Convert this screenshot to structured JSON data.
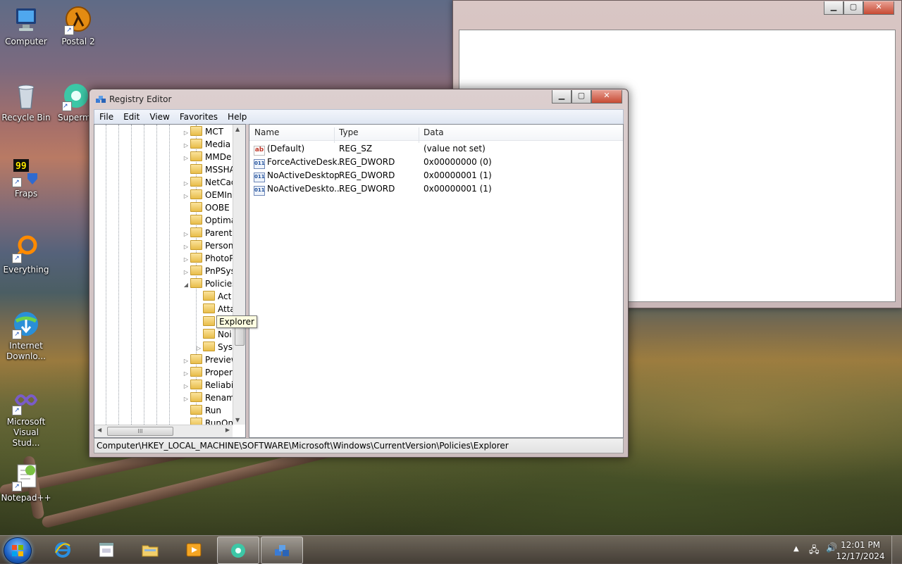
{
  "desktop": {
    "icons": [
      {
        "label": "Computer"
      },
      {
        "label": "Postal 2"
      },
      {
        "label": "Recycle Bin"
      },
      {
        "label": "Supermi"
      },
      {
        "label": "Fraps"
      },
      {
        "label": "Everything"
      },
      {
        "label": "Internet Downlo..."
      },
      {
        "label": "Microsoft Visual Stud..."
      },
      {
        "label": "Notepad++"
      }
    ]
  },
  "registry": {
    "title": "Registry Editor",
    "menu": [
      "File",
      "Edit",
      "View",
      "Favorites",
      "Help"
    ],
    "tree": [
      {
        "label": "MCT",
        "depth": 0,
        "expander": "▷"
      },
      {
        "label": "Media",
        "depth": 0,
        "expander": "▷"
      },
      {
        "label": "MMDe",
        "depth": 0,
        "expander": "▷"
      },
      {
        "label": "MSSHA",
        "depth": 0,
        "expander": ""
      },
      {
        "label": "NetCac",
        "depth": 0,
        "expander": "▷"
      },
      {
        "label": "OEMIn",
        "depth": 0,
        "expander": "▷"
      },
      {
        "label": "OOBE",
        "depth": 0,
        "expander": ""
      },
      {
        "label": "Optima",
        "depth": 0,
        "expander": ""
      },
      {
        "label": "Parenta",
        "depth": 0,
        "expander": "▷"
      },
      {
        "label": "Person",
        "depth": 0,
        "expander": "▷"
      },
      {
        "label": "PhotoP",
        "depth": 0,
        "expander": "▷"
      },
      {
        "label": "PnPSys",
        "depth": 0,
        "expander": "▷"
      },
      {
        "label": "Policies",
        "depth": 0,
        "expander": "◢"
      },
      {
        "label": "Act",
        "depth": 1,
        "expander": ""
      },
      {
        "label": "Atta",
        "depth": 1,
        "expander": ""
      },
      {
        "label": "Explorer",
        "depth": 1,
        "expander": ""
      },
      {
        "label": "Noi",
        "depth": 1,
        "expander": ""
      },
      {
        "label": "Sys",
        "depth": 1,
        "expander": "▷"
      },
      {
        "label": "Preview",
        "depth": 0,
        "expander": "▷"
      },
      {
        "label": "Proper",
        "depth": 0,
        "expander": "▷"
      },
      {
        "label": "Reliabi",
        "depth": 0,
        "expander": "▷"
      },
      {
        "label": "Renam",
        "depth": 0,
        "expander": "▷"
      },
      {
        "label": "Run",
        "depth": 0,
        "expander": ""
      },
      {
        "label": "RunOn",
        "depth": 0,
        "expander": ""
      }
    ],
    "tooltip": "Explorer",
    "columns": {
      "name": "Name",
      "type": "Type",
      "data": "Data"
    },
    "values": [
      {
        "name": "(Default)",
        "type": "REG_SZ",
        "data": "(value not set)",
        "icon": "ab"
      },
      {
        "name": "ForceActiveDesk...",
        "type": "REG_DWORD",
        "data": "0x00000000 (0)",
        "icon": "bin"
      },
      {
        "name": "NoActiveDesktop",
        "type": "REG_DWORD",
        "data": "0x00000001 (1)",
        "icon": "bin"
      },
      {
        "name": "NoActiveDeskto...",
        "type": "REG_DWORD",
        "data": "0x00000001 (1)",
        "icon": "bin"
      }
    ],
    "status_path": "Computer\\HKEY_LOCAL_MACHINE\\SOFTWARE\\Microsoft\\Windows\\CurrentVersion\\Policies\\Explorer"
  },
  "taskbar": {
    "clock_time": "12:01 PM",
    "clock_date": "12/17/2024",
    "tray_icons": [
      "chevron-up-icon",
      "network-icon",
      "speaker-icon"
    ]
  },
  "colors": {
    "close_button": "#c74a33",
    "start_orb": "#1b5fc2",
    "tooltip_bg": "#ffffe1"
  }
}
